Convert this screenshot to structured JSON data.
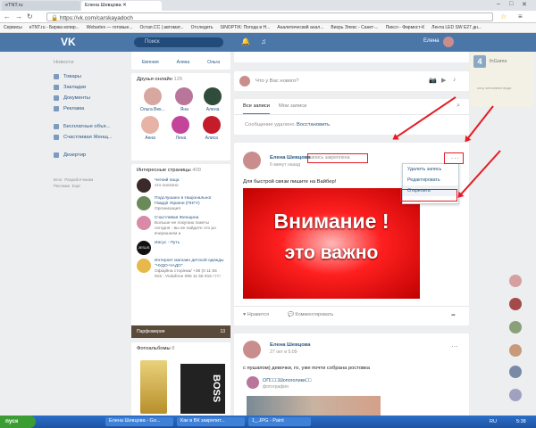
{
  "browser": {
    "tabs": [
      {
        "label": "eTNT.ru"
      },
      {
        "label": "Елена Шевцова"
      }
    ],
    "url": "https://vk.com/carskayadoch",
    "bookmarks": [
      "Сервисы",
      "eTNT.ru - Биржа копир...",
      "Webartex — готовые...",
      "Остап.CC | автомат...",
      "Отследить",
      "SINOPTIK: Погода в Н...",
      "Аналитический анал...",
      "Вихрь Элекс - Санкт-...",
      "Пиксл - Фирмост-К",
      "Лента LED SW E27 дн..."
    ]
  },
  "vk": {
    "search_placeholder": "Поиск",
    "user_name": "Елена"
  },
  "sidebar": {
    "items": [
      "Новости",
      "Товары",
      "Закладки",
      "Документы",
      "Реклама",
      "Бесплатные объя...",
      "Счастливая Женщ...",
      "Дезертир"
    ],
    "footer": [
      "Блог",
      "Разработчикам",
      "Реклама",
      "Ещё"
    ]
  },
  "friends_top": {
    "names": [
      "Евгения",
      "Алина",
      "Ольга"
    ]
  },
  "friends_online": {
    "title": "Друзья онлайн",
    "count": "126",
    "names": [
      "Ольга Век...",
      "Яна",
      "Алена",
      "Анна",
      "Лена",
      "Алиса"
    ]
  },
  "pages": {
    "title": "Интересные страницы",
    "count": "409",
    "items": [
      {
        "name": "Четкий паца",
        "sub": "это полезно"
      },
      {
        "name": "Подслушано в Національної Гвардії України (ПНГУ)",
        "sub": "Организация"
      },
      {
        "name": "Счастливая Женщина",
        "sub": "Больше не покупаю пакеты сегодня - вы не найдете это ро вчерашнем и"
      },
      {
        "name": "Иисус - Путь",
        "sub": ""
      },
      {
        "name": "Интернет магазин детской одежды \"ЧУДО-ЧАДО\"",
        "sub": "Офіційна сторінка/ +38 (0 11 55 915 ; Vodafone 095 11 55 915 □□□"
      }
    ],
    "photo_label": "Парфюмерия",
    "photo_count": "13"
  },
  "photos": {
    "title": "Фотоальбомы",
    "count": "8",
    "brand": "BOSS"
  },
  "composer": {
    "placeholder": "Что у Вас нового?"
  },
  "wall": {
    "tabs": [
      "Все записи",
      "Мои записи"
    ],
    "deleted_text": "Сообщение удалено.",
    "restore_link": "Восстановить"
  },
  "post1": {
    "author": "Елена Шевцова",
    "pinned": "запись закреплена",
    "time": "6 минут назад",
    "text": "Для быстрой связи пишите на Вайбер!",
    "image_line1": "Внимание !",
    "image_line2": "это важно",
    "like_label": "Нравится",
    "comment_label": "Комментировать",
    "menu": [
      "Удалить запись",
      "Редактировать",
      "Открепить"
    ],
    "more_icon": "..."
  },
  "post2": {
    "author": "Елена Шевцова",
    "time": "27 окт в 5:09",
    "text": "с пушапом) девочки, го, уже почти собрана ростовка",
    "repost_name": "ОП□□□Шопоголики□□",
    "repost_sub": "фотография"
  },
  "right": {
    "ad1": "fnGame",
    "ad2": "сочу желанием вида"
  },
  "taskbar": {
    "start": "пуск",
    "items": [
      "Елена Шевцова - Go...",
      "Как в ВК закрепит...",
      "1_.JPG - Paint"
    ],
    "lang": "RU",
    "clock": "5:38"
  },
  "colors": {
    "vk_blue": "#4a76a8",
    "annotation_red": "#e51b24",
    "banner_red": "#d40000"
  }
}
